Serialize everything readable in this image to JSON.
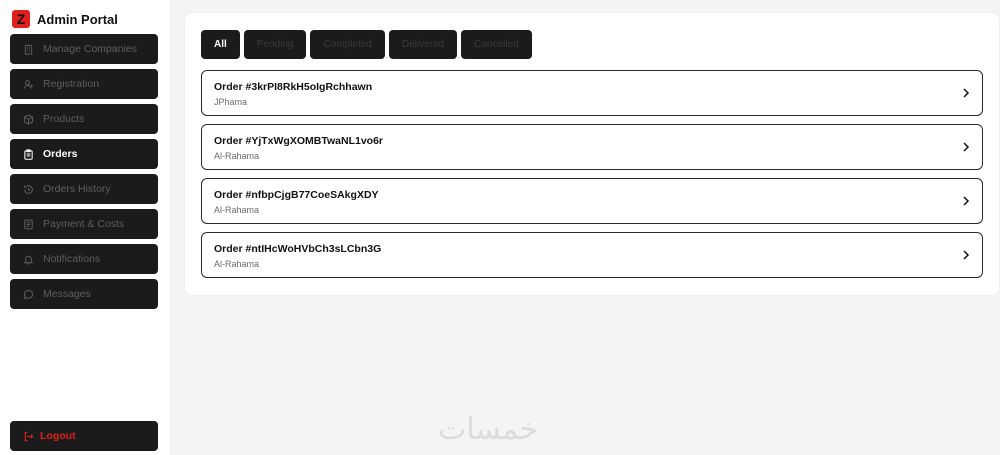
{
  "sidebar": {
    "brand": {
      "logo_letter": "Z",
      "title": "Admin Portal",
      "logo_color": "#e0201c"
    },
    "items": [
      {
        "label": "Manage Companies",
        "icon": "building-icon",
        "active": false
      },
      {
        "label": "Registration",
        "icon": "user-plus-icon",
        "active": false
      },
      {
        "label": "Products",
        "icon": "package-icon",
        "active": false
      },
      {
        "label": "Orders",
        "icon": "clipboard-icon",
        "active": true
      },
      {
        "label": "Orders History",
        "icon": "history-icon",
        "active": false
      },
      {
        "label": "Payment & Costs",
        "icon": "receipt-icon",
        "active": false
      },
      {
        "label": "Notifications",
        "icon": "bell-icon",
        "active": false
      },
      {
        "label": "Messages",
        "icon": "message-circle-icon",
        "active": false
      }
    ],
    "logout": {
      "label": "Logout",
      "icon": "logout-icon",
      "color": "#e0201c"
    }
  },
  "filters": {
    "tabs": [
      {
        "label": "All",
        "active": true
      },
      {
        "label": "Pending",
        "active": false
      },
      {
        "label": "Completed",
        "active": false
      },
      {
        "label": "Delivered",
        "active": false
      },
      {
        "label": "Cancelled",
        "active": false
      }
    ]
  },
  "orders": [
    {
      "title": "Order #3krPI8RkH5oIgRchhawn",
      "company": "JPhama"
    },
    {
      "title": "Order #YjTxWgXOMBTwaNL1vo6r",
      "company": "Al-Rahama"
    },
    {
      "title": "Order #nfbpCjgB77CoeSAkgXDY",
      "company": "Al-Rahama"
    },
    {
      "title": "Order #ntIHcWoHVbCh3sLCbn3G",
      "company": "Al-Rahama"
    }
  ],
  "watermark": "خمسات"
}
